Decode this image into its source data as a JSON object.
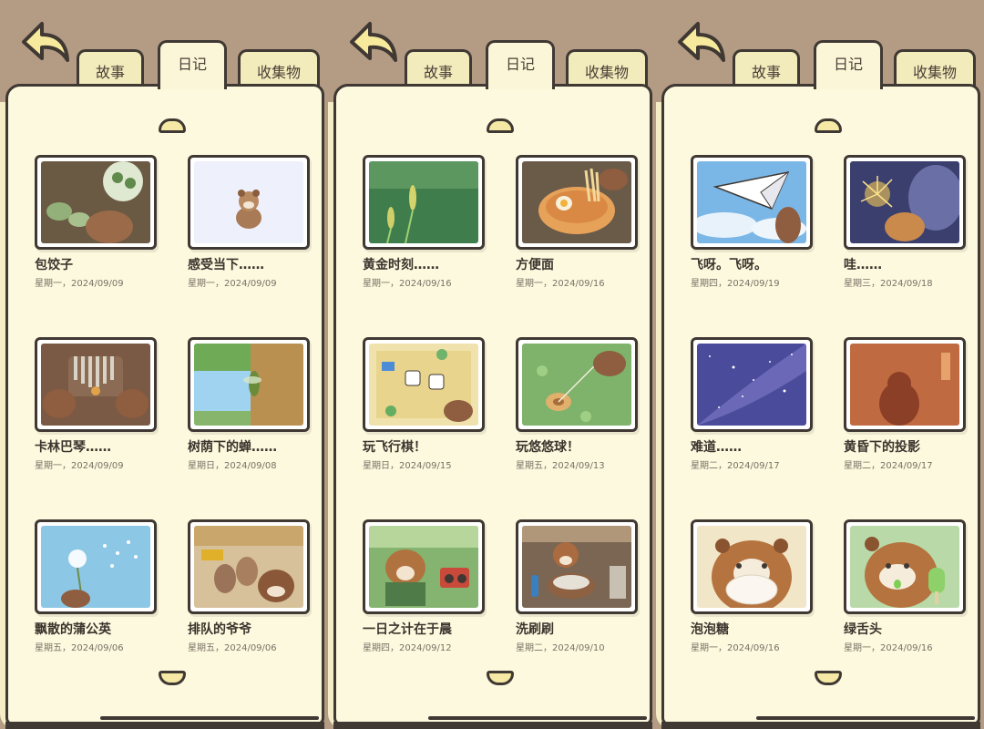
{
  "tabs": {
    "story": "故事",
    "diary": "日记",
    "collection": "收集物"
  },
  "pages": [
    {
      "entries": [
        {
          "title": "包饺子",
          "date": "星期一，2024/09/09",
          "art": "dumplings"
        },
        {
          "title": "感受当下……",
          "date": "星期一，2024/09/09",
          "art": "squirrel-small"
        },
        {
          "title": "卡林巴琴……",
          "date": "星期一，2024/09/09",
          "art": "kalimba"
        },
        {
          "title": "树荫下的蝉……",
          "date": "星期日，2024/09/08",
          "art": "cicada"
        },
        {
          "title": "飘散的蒲公英",
          "date": "星期五，2024/09/06",
          "art": "dandelion"
        },
        {
          "title": "排队的爷爷",
          "date": "星期五，2024/09/06",
          "art": "queue"
        }
      ]
    },
    {
      "entries": [
        {
          "title": "黄金时刻……",
          "date": "星期一，2024/09/16",
          "art": "grass"
        },
        {
          "title": "方便面",
          "date": "星期一，2024/09/16",
          "art": "noodles"
        },
        {
          "title": "玩飞行棋！",
          "date": "星期日，2024/09/15",
          "art": "boardgame"
        },
        {
          "title": "玩悠悠球！",
          "date": "星期五，2024/09/13",
          "art": "yoyo"
        },
        {
          "title": "一日之计在于晨",
          "date": "星期四，2024/09/12",
          "art": "radio"
        },
        {
          "title": "洗刷刷",
          "date": "星期二，2024/09/10",
          "art": "dishes"
        }
      ]
    },
    {
      "entries": [
        {
          "title": "飞呀。飞呀。",
          "date": "星期四，2024/09/19",
          "art": "paperplane"
        },
        {
          "title": "哇……",
          "date": "星期三，2024/09/18",
          "art": "sparkler"
        },
        {
          "title": "难道……",
          "date": "星期二，2024/09/17",
          "art": "stars"
        },
        {
          "title": "黄昏下的投影",
          "date": "星期二，2024/09/17",
          "art": "shadow"
        },
        {
          "title": "泡泡糖",
          "date": "星期一，2024/09/16",
          "art": "bubblegum"
        },
        {
          "title": "绿舌头",
          "date": "星期一，2024/09/16",
          "art": "popsicle"
        }
      ]
    }
  ],
  "colors": {
    "background": "#b39b84",
    "paper": "#fdf9de",
    "outline": "#3f3833",
    "tab": "#f2ecbd"
  }
}
